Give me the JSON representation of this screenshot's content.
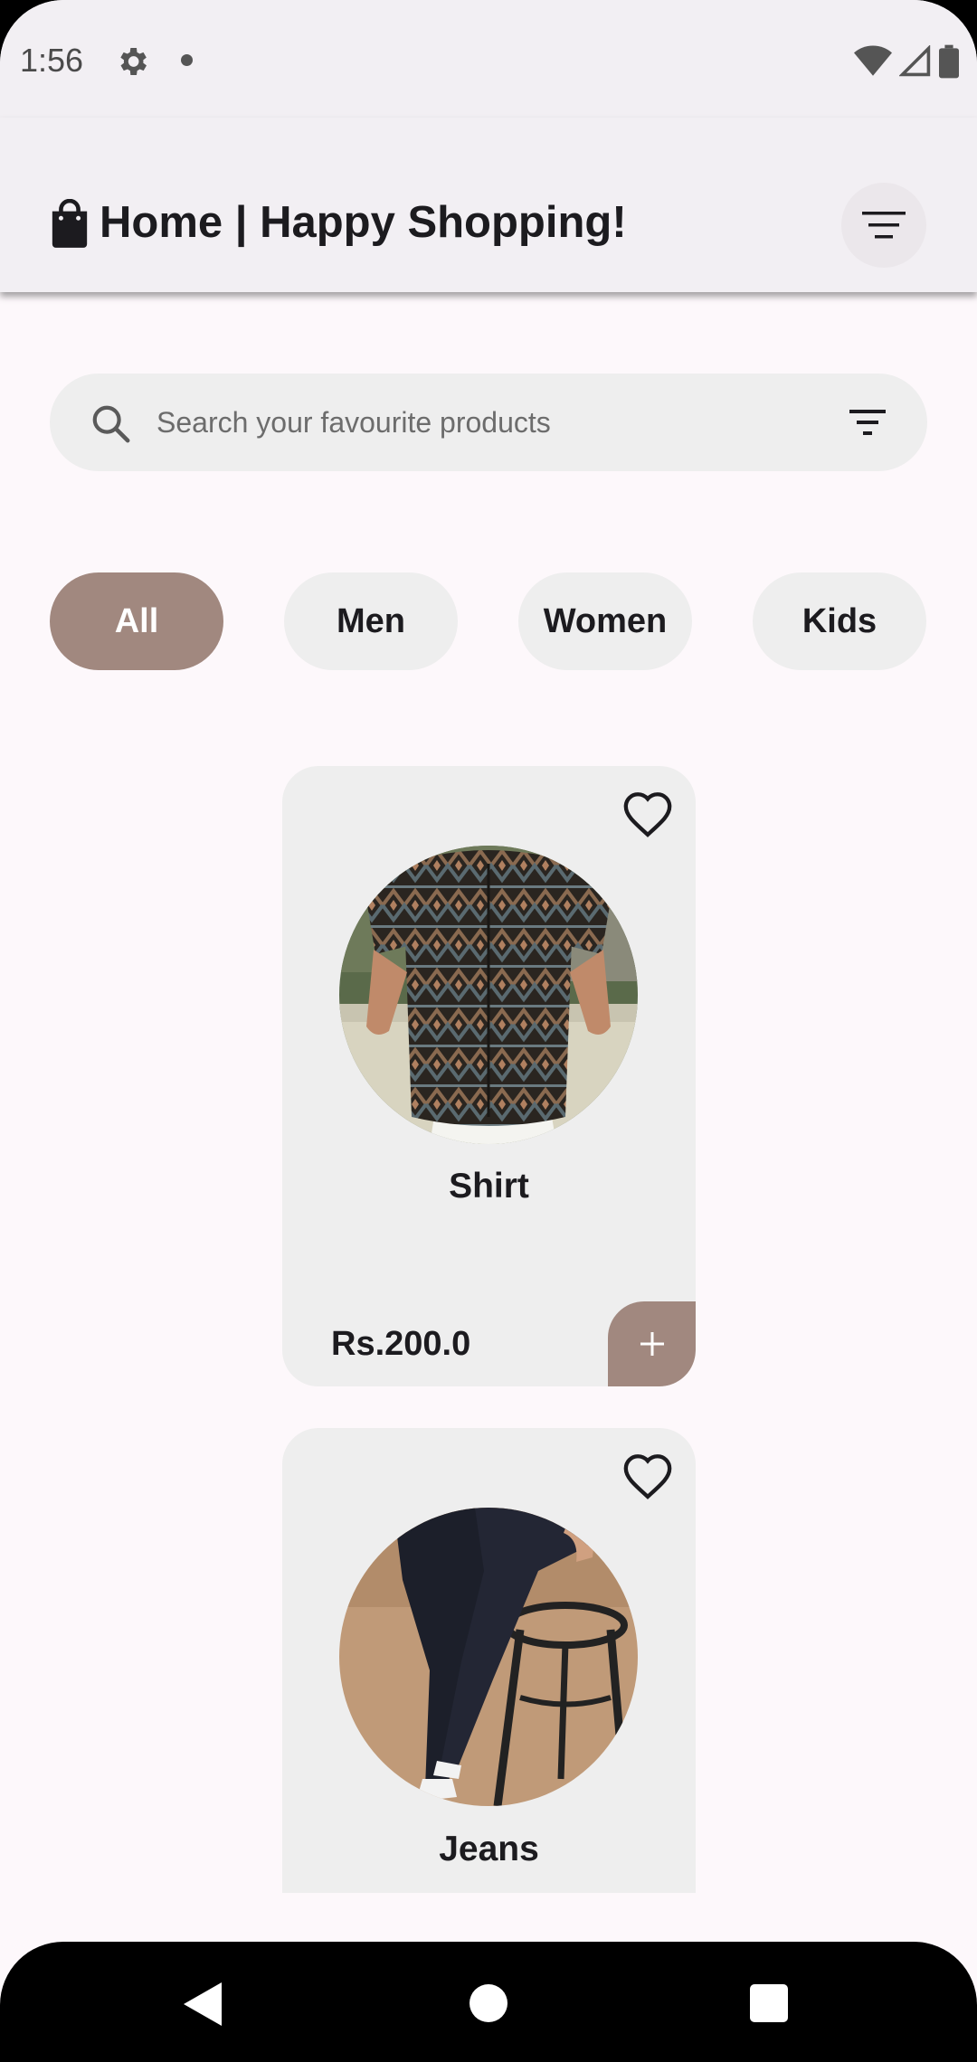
{
  "status_bar": {
    "time": "1:56",
    "icons": [
      "gear-icon",
      "notification-dot-icon",
      "wifi-icon",
      "signal-icon",
      "battery-icon"
    ]
  },
  "app_bar": {
    "title": "Home | Happy Shopping!",
    "leading_icon": "shopping-bag-icon",
    "trailing_icon": "menu-lines-icon"
  },
  "search": {
    "placeholder": "Search your favourite products",
    "leading_icon": "search-icon",
    "trailing_icon": "filter-icon"
  },
  "categories": [
    {
      "label": "All",
      "selected": true
    },
    {
      "label": "Men",
      "selected": false
    },
    {
      "label": "Women",
      "selected": false
    },
    {
      "label": "Kids",
      "selected": false
    }
  ],
  "products": [
    {
      "name": "Shirt",
      "price": "Rs.200.0",
      "favorite_icon": "heart-outline-icon",
      "add_icon": "plus-icon"
    },
    {
      "name": "Jeans",
      "favorite_icon": "heart-outline-icon"
    }
  ],
  "colors": {
    "accent": "#a1887f",
    "surface": "#eeeeee",
    "background": "#fdf8fb",
    "bar": "#f2eff3"
  },
  "nav_bar": {
    "icons": [
      "back-icon",
      "home-icon",
      "recents-icon"
    ]
  }
}
